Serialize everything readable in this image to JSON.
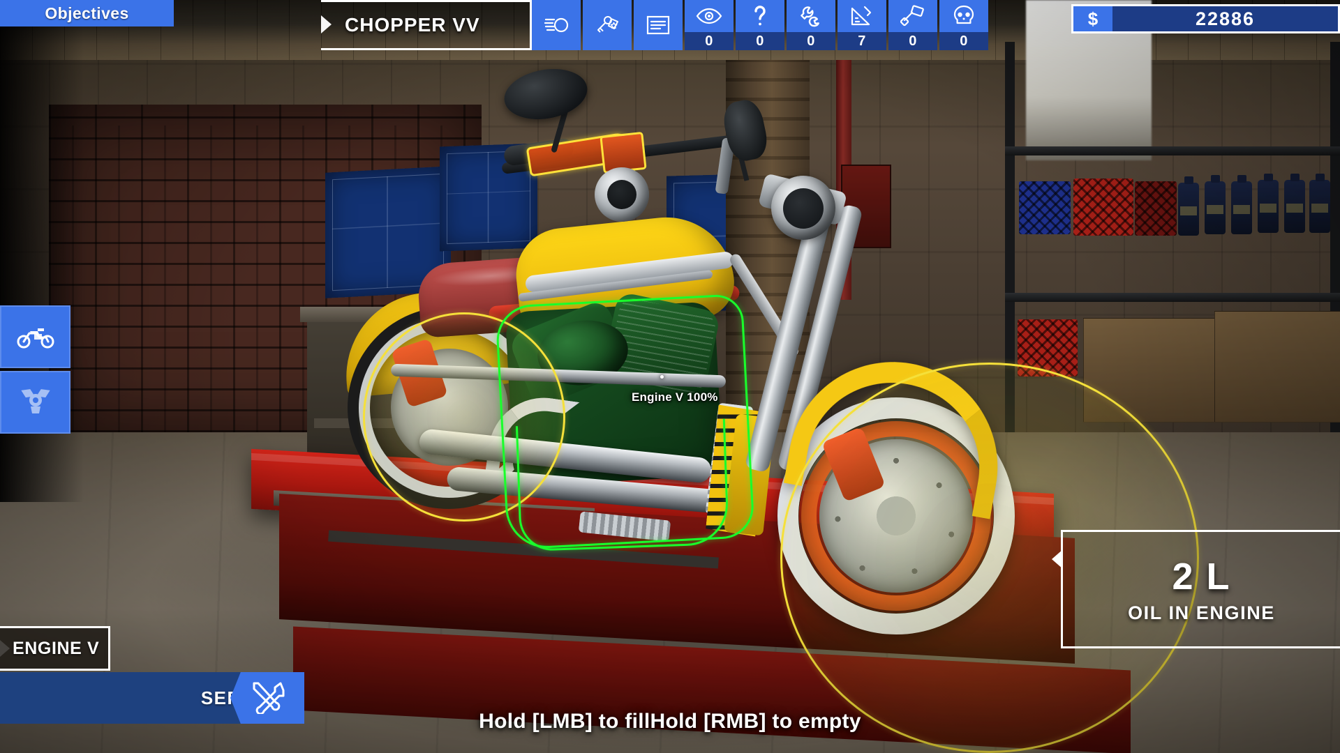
{
  "hud": {
    "objectives_label": "Objectives",
    "vehicle_name": "CHOPPER VV",
    "money_symbol": "$",
    "money_value": "22886",
    "part_name": "ENGINE V",
    "service_label": "SERVICE",
    "hint_text": "Hold [LMB] to fillHold [RMB] to empty",
    "tooltip": "Engine V 100%"
  },
  "status_icons": [
    {
      "name": "headlight-icon",
      "icon": "headlight",
      "count": null
    },
    {
      "name": "keys-icon",
      "icon": "keys",
      "count": null
    },
    {
      "name": "notes-icon",
      "icon": "notes",
      "count": null
    },
    {
      "name": "visual-icon",
      "icon": "eye",
      "count": "0"
    },
    {
      "name": "unknown-icon",
      "icon": "question",
      "count": "0"
    },
    {
      "name": "repair-icon",
      "icon": "wrench",
      "count": "0"
    },
    {
      "name": "tuning-icon",
      "icon": "ruler",
      "count": "7"
    },
    {
      "name": "paint-icon",
      "icon": "roller",
      "count": "0"
    },
    {
      "name": "damage-icon",
      "icon": "skull",
      "count": "0"
    }
  ],
  "side_tabs": [
    {
      "name": "vehicle-tab",
      "icon": "motorcycle",
      "active": true
    },
    {
      "name": "engine-tab",
      "icon": "v-engine",
      "active": false
    }
  ],
  "oil_panel": {
    "amount": "2 L",
    "label": "OIL IN ENGINE"
  },
  "colors": {
    "accent_blue": "#3b73e8",
    "dark_blue": "#1d3c86",
    "panel_blue": "#1e417f",
    "highlight_yellow": "#f5e03a",
    "selection_green": "#19ff2b",
    "white": "#ffffff"
  }
}
